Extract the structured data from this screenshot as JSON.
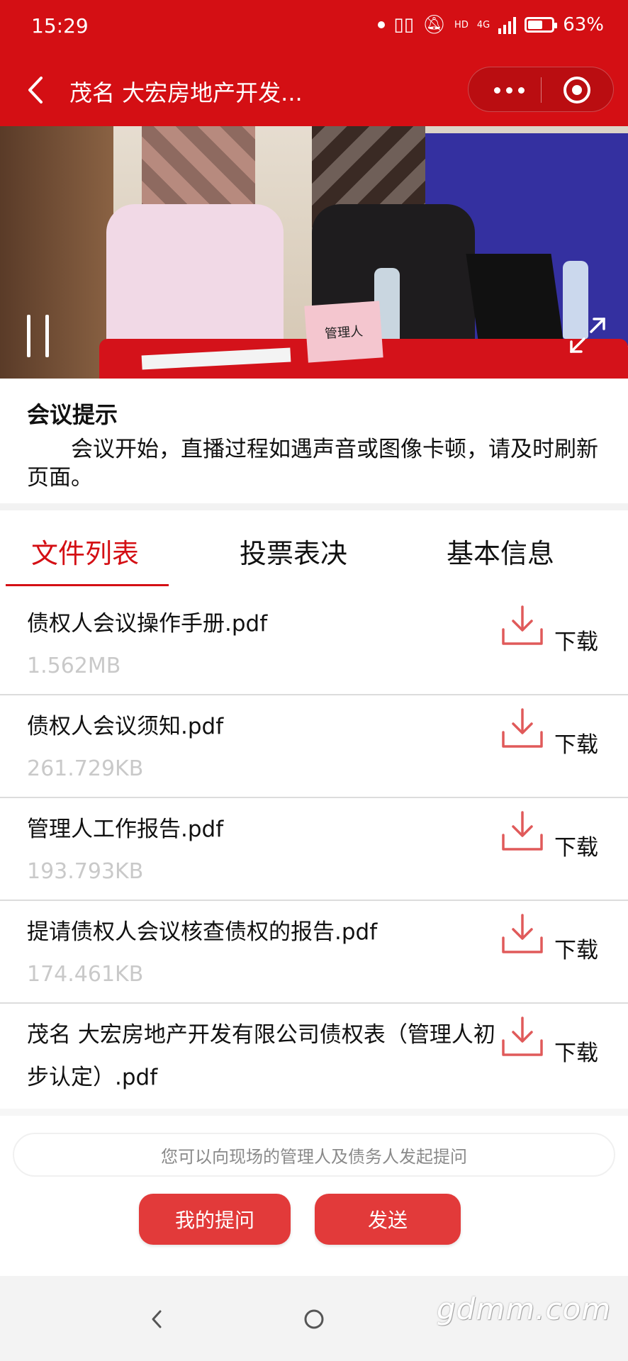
{
  "status_bar": {
    "time": "15:29",
    "network": "4G",
    "hd": "HD",
    "battery_level": 0.63,
    "battery_text": "63%"
  },
  "nav": {
    "title": "茂名 大宏房地产开发...",
    "back_icon": "chevron-left-icon",
    "more_icon": "more-dots-icon",
    "close_icon": "target-circle-icon"
  },
  "video": {
    "nameplate": "管理人",
    "pause_icon": "pause-icon",
    "fullscreen_icon": "fullscreen-icon"
  },
  "notice": {
    "title": "会议提示",
    "body": "会议开始，直播过程如遇声音或图像卡顿，请及时刷新页面。"
  },
  "tabs": [
    {
      "label": "文件列表",
      "active": true
    },
    {
      "label": "投票表决",
      "active": false
    },
    {
      "label": "基本信息",
      "active": false
    }
  ],
  "files": [
    {
      "name": "债权人会议操作手册.pdf",
      "size": "1.562MB",
      "download": "下载"
    },
    {
      "name": "债权人会议须知.pdf",
      "size": "261.729KB",
      "download": "下载"
    },
    {
      "name": "管理人工作报告.pdf",
      "size": "193.793KB",
      "download": "下载"
    },
    {
      "name": "提请债权人会议核查债权的报告.pdf",
      "size": "174.461KB",
      "download": "下载"
    },
    {
      "name": "茂名 大宏房地产开发有限公司债权表（管理人初步认定）.pdf",
      "size": "",
      "download": "下载"
    }
  ],
  "footer": {
    "question_placeholder": "您可以向现场的管理人及债务人发起提问",
    "my_questions": "我的提问",
    "send": "发送"
  },
  "watermark": "gdmm.com",
  "colors": {
    "brand_red": "#d40f14",
    "button_red": "#e23a3a",
    "download_icon": "#e05a5a",
    "muted_text": "#c9c9c9"
  }
}
